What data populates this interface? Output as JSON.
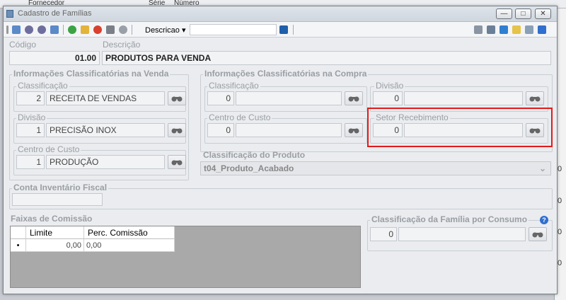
{
  "background": {
    "top_left": "Fornecedor",
    "top_mid_1": "Série",
    "top_mid_2": "Número",
    "right_edge_chars": [
      "0",
      "0",
      "0",
      "0"
    ]
  },
  "window": {
    "title": "Cadastro de Famílias",
    "controls": {
      "minimize": "—",
      "maximize": "□",
      "close": "✕"
    }
  },
  "toolbar": {
    "search_field_label": "Descricao",
    "search_value": ""
  },
  "header": {
    "codigo_label": "Código",
    "codigo_value": "01.00",
    "descricao_label": "Descrição",
    "descricao_value": "PRODUTOS PARA VENDA"
  },
  "venda": {
    "title": "Informações Classificatórias na Venda",
    "classificacao": {
      "label": "Classificação",
      "code": "2",
      "text": "RECEITA DE VENDAS"
    },
    "divisao": {
      "label": "Divisão",
      "code": "1",
      "text": "PRECISÃO INOX"
    },
    "centro": {
      "label": "Centro de Custo",
      "code": "1",
      "text": "PRODUÇÃO"
    }
  },
  "compra": {
    "title": "Informações Classificatórias na Compra",
    "classificacao": {
      "label": "Classificação",
      "code": "0",
      "text": ""
    },
    "divisao": {
      "label": "Divisão",
      "code": "0",
      "text": ""
    },
    "centro": {
      "label": "Centro de Custo",
      "code": "0",
      "text": ""
    },
    "setor": {
      "label": "Setor Recebimento",
      "code": "0",
      "text": ""
    }
  },
  "produto": {
    "label": "Classificação do Produto",
    "value": "t04_Produto_Acabado"
  },
  "inventario": {
    "label": "Conta Inventário Fiscal",
    "value": ""
  },
  "comissao": {
    "title": "Faixas de Comissão",
    "columns": [
      "Limite",
      "Perc. Comissão"
    ],
    "rows": [
      {
        "marker": "•",
        "limite": "0,00",
        "perc": "0,00"
      }
    ]
  },
  "consumo": {
    "label": "Classificação da Família por Consumo",
    "code": "0",
    "text": "",
    "help": "?"
  },
  "colors": {
    "highlight": "#e21b1b",
    "window_bg": "#eaecef"
  }
}
